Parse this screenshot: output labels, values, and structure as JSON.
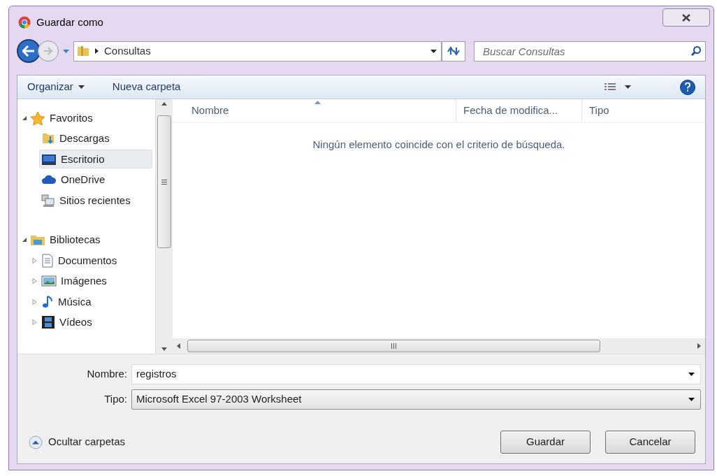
{
  "window": {
    "title": "Guardar como"
  },
  "address": {
    "breadcrumb": [
      "Consultas"
    ]
  },
  "search": {
    "placeholder": "Buscar Consultas"
  },
  "toolbar": {
    "buttons": [
      {
        "label": "Organizar",
        "menu": true
      },
      {
        "label": "Nueva carpeta",
        "menu": false
      }
    ]
  },
  "sidebar": {
    "groups": [
      {
        "label": "Favoritos",
        "expanded": true,
        "items": [
          {
            "label": "Descargas",
            "selected": false
          },
          {
            "label": "Escritorio",
            "selected": true
          },
          {
            "label": "OneDrive",
            "selected": false
          },
          {
            "label": "Sitios recientes",
            "selected": false
          }
        ]
      },
      {
        "label": "Bibliotecas",
        "expanded": true,
        "items": [
          {
            "label": "Documentos",
            "selected": false,
            "expanded": false
          },
          {
            "label": "Imágenes",
            "selected": false,
            "expanded": false
          },
          {
            "label": "Música",
            "selected": false,
            "expanded": false
          },
          {
            "label": "Vídeos",
            "selected": false,
            "expanded": false
          }
        ]
      }
    ]
  },
  "file_list": {
    "columns": [
      {
        "label": "Nombre",
        "sorted": true
      },
      {
        "label": "Fecha de modifica...",
        "sorted": false
      },
      {
        "label": "Tipo",
        "sorted": false
      }
    ],
    "empty_message": "Ningún elemento coincide con el criterio de búsqueda."
  },
  "form": {
    "fields": [
      {
        "label": "Nombre:",
        "value": "registros",
        "kind": "combo"
      },
      {
        "label": "Tipo:",
        "value": "Microsoft Excel 97-2003 Worksheet",
        "kind": "select"
      }
    ]
  },
  "footer": {
    "toggle": "Ocultar carpetas",
    "buttons": [
      "Guardar",
      "Cancelar"
    ]
  }
}
